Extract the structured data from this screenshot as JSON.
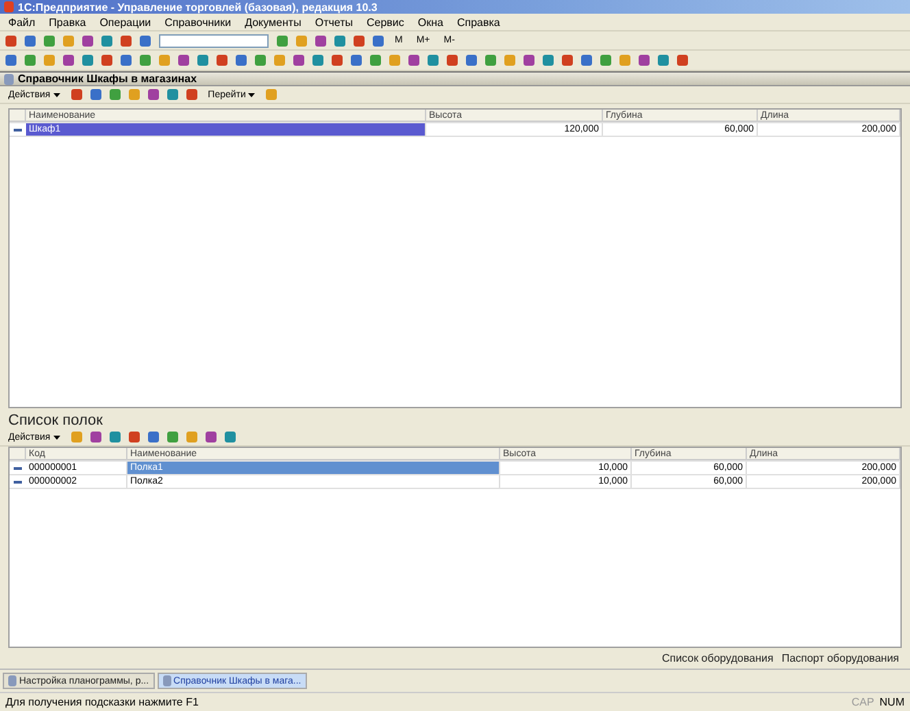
{
  "window": {
    "title": "1С:Предприятие - Управление торговлей (базовая), редакция 10.3"
  },
  "menu": [
    "Файл",
    "Правка",
    "Операции",
    "Справочники",
    "Документы",
    "Отчеты",
    "Сервис",
    "Окна",
    "Справка"
  ],
  "calc_buttons": [
    "M",
    "M+",
    "M-"
  ],
  "form": {
    "title": "Справочник Шкафы в магазинах",
    "actions_label": "Действия",
    "goto_label": "Перейти",
    "table": {
      "columns": [
        "Наименование",
        "Высота",
        "Глубина",
        "Длина"
      ],
      "rows": [
        {
          "cells": [
            "Шкаф1",
            "120,000",
            "60,000",
            "200,000"
          ],
          "selected": true
        }
      ]
    }
  },
  "shelves": {
    "title": "Список полок",
    "actions_label": "Действия",
    "table": {
      "columns": [
        "Код",
        "Наименование",
        "Высота",
        "Глубина",
        "Длина"
      ],
      "rows": [
        {
          "cells": [
            "000000001",
            "Полка1",
            "10,000",
            "60,000",
            "200,000"
          ],
          "selected": true
        },
        {
          "cells": [
            "000000002",
            "Полка2",
            "10,000",
            "60,000",
            "200,000"
          ],
          "selected": false
        }
      ]
    }
  },
  "links": [
    "Список оборудования",
    "Паспорт оборудования"
  ],
  "taskbar": [
    {
      "label": "Настройка планограммы, р...",
      "selected": false
    },
    {
      "label": "Справочник Шкафы в мага...",
      "selected": true
    }
  ],
  "status_bar": {
    "hint": "Для получения подсказки нажмите F1",
    "indicators": [
      {
        "label": "CAP",
        "on": false
      },
      {
        "label": "NUM",
        "on": true
      }
    ]
  }
}
